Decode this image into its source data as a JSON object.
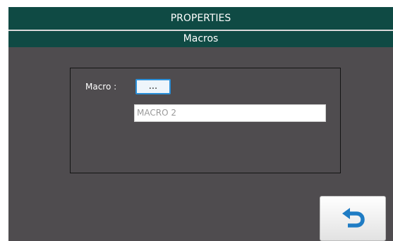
{
  "header": {
    "title": "PROPERTIES",
    "subtitle": "Macros"
  },
  "form": {
    "macro_label": "Macro :",
    "pick_button_label": "...",
    "macro_value": "MACRO 2"
  },
  "footer": {
    "back_button_icon": "undo-arrow-icon"
  },
  "colors": {
    "header_bg": "#0f4a44",
    "screen_bg": "#4f4c4f",
    "accent": "#2a8fd8",
    "back_icon": "#1f7cc4"
  }
}
